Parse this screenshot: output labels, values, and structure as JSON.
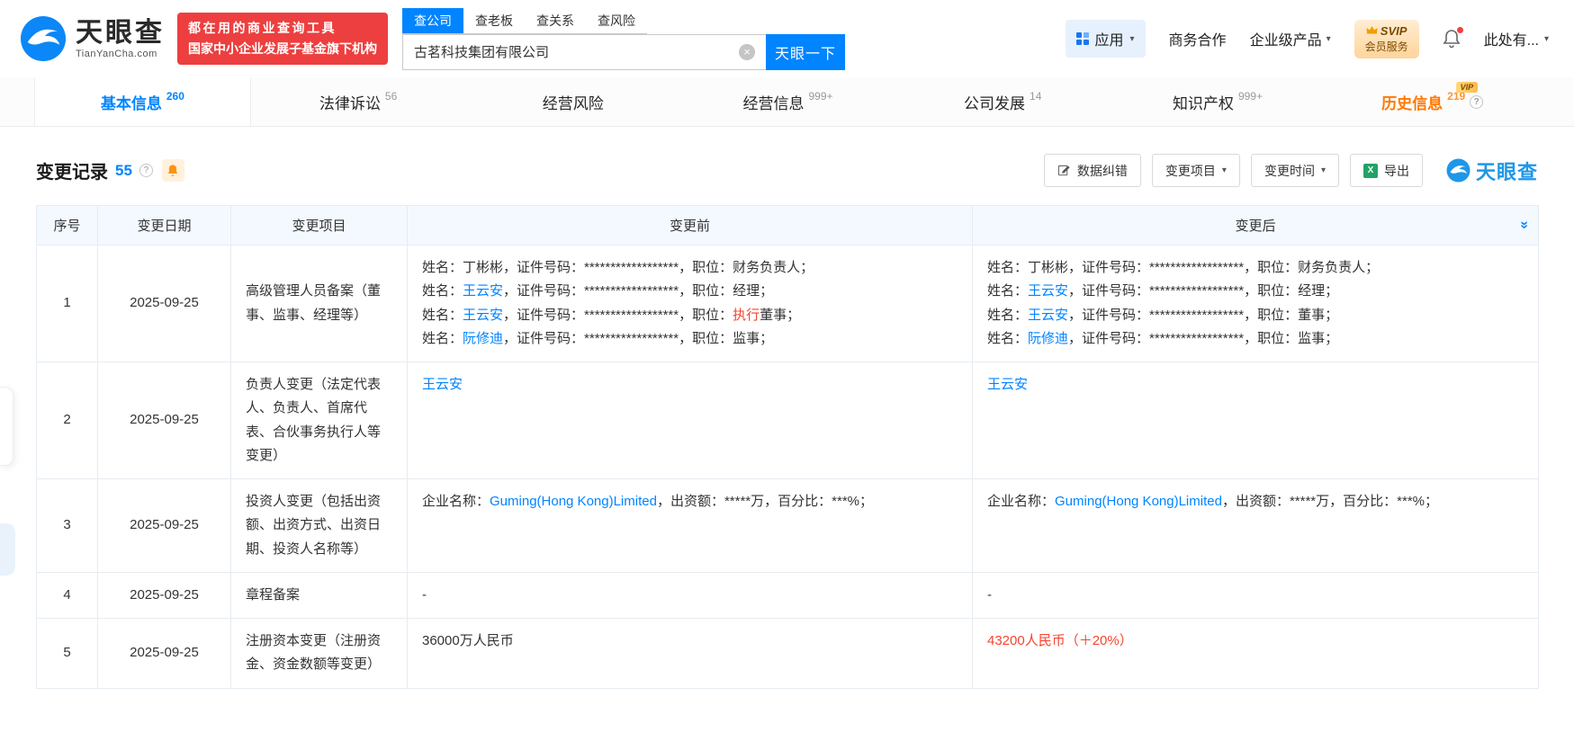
{
  "colors": {
    "brand_blue": "#0084ff",
    "link_blue": "#0084ff",
    "highlight_red": "#f5442e",
    "history_orange": "#ff7800",
    "slogan_red": "#ed3f3f",
    "table_header_bg": "#f3f9ff"
  },
  "header": {
    "logo": {
      "name": "天眼查",
      "domain": "TianYanCha.com"
    },
    "slogan": {
      "line1": "都在用的商业查询工具",
      "line2": "国家中小企业发展子基金旗下机构"
    },
    "search_tabs": [
      {
        "label": "查公司",
        "active": true
      },
      {
        "label": "查老板",
        "active": false
      },
      {
        "label": "查关系",
        "active": false
      },
      {
        "label": "查风险",
        "active": false
      }
    ],
    "search": {
      "value": "古茗科技集团有限公司",
      "button": "天眼一下"
    },
    "nav": {
      "apps": "应用",
      "cooperation": "商务合作",
      "enterprise": "企业级产品",
      "svip_top": "SVIP",
      "svip_bottom": "会员服务",
      "user": "此处有..."
    }
  },
  "tabs": [
    {
      "id": "basic-info",
      "label": "基本信息",
      "count": "260",
      "active": true
    },
    {
      "id": "legal-litigation",
      "label": "法律诉讼",
      "count": "56"
    },
    {
      "id": "operation-risk",
      "label": "经营风险",
      "count": ""
    },
    {
      "id": "operation-info",
      "label": "经营信息",
      "count": "999+"
    },
    {
      "id": "company-development",
      "label": "公司发展",
      "count": "14"
    },
    {
      "id": "intellectual-property",
      "label": "知识产权",
      "count": "999+"
    },
    {
      "id": "history-info",
      "label": "历史信息",
      "count": "219",
      "vip": "VIP",
      "info": true,
      "highlight": true
    }
  ],
  "section": {
    "title": "变更记录",
    "count": "55",
    "tools": {
      "correction": "数据纠错",
      "filter_item": "变更项目",
      "filter_time": "变更时间",
      "export": "导出"
    },
    "watermark": "天眼查"
  },
  "table": {
    "headers": [
      "序号",
      "变更日期",
      "变更项目",
      "变更前",
      "变更后"
    ],
    "rows": [
      {
        "seq": "1",
        "date": "2025-09-25",
        "item": "高级管理人员备案（董事、监事、经理等）",
        "before": [
          [
            {
              "t": "姓名：丁彬彬，证件号码：******************，职位：财务负责人；"
            }
          ],
          [
            {
              "t": "姓名："
            },
            {
              "t": "王云安",
              "link": true
            },
            {
              "t": "，证件号码：******************，职位：经理；"
            }
          ],
          [
            {
              "t": "姓名："
            },
            {
              "t": "王云安",
              "link": true
            },
            {
              "t": "，证件号码：******************，职位："
            },
            {
              "t": "执行",
              "red": true
            },
            {
              "t": "董事；"
            }
          ],
          [
            {
              "t": "姓名："
            },
            {
              "t": "阮修迪",
              "link": true
            },
            {
              "t": "，证件号码：******************，职位：监事；"
            }
          ]
        ],
        "after": [
          [
            {
              "t": "姓名：丁彬彬，证件号码：******************，职位：财务负责人；"
            }
          ],
          [
            {
              "t": "姓名："
            },
            {
              "t": "王云安",
              "link": true
            },
            {
              "t": "，证件号码：******************，职位：经理；"
            }
          ],
          [
            {
              "t": "姓名："
            },
            {
              "t": "王云安",
              "link": true
            },
            {
              "t": "，证件号码：******************，职位：董事；"
            }
          ],
          [
            {
              "t": "姓名："
            },
            {
              "t": "阮修迪",
              "link": true
            },
            {
              "t": "，证件号码：******************，职位：监事；"
            }
          ]
        ]
      },
      {
        "seq": "2",
        "date": "2025-09-25",
        "item": "负责人变更（法定代表人、负责人、首席代表、合伙事务执行人等变更）",
        "before": [
          [
            {
              "t": "王云安",
              "link": true
            }
          ]
        ],
        "after": [
          [
            {
              "t": "王云安",
              "link": true
            }
          ]
        ]
      },
      {
        "seq": "3",
        "date": "2025-09-25",
        "item": "投资人变更（包括出资额、出资方式、出资日期、投资人名称等）",
        "before": [
          [
            {
              "t": "企业名称："
            },
            {
              "t": "Guming(Hong Kong)Limited",
              "link": true
            },
            {
              "t": "，出资额：*****万，百分比：***%；"
            }
          ]
        ],
        "after": [
          [
            {
              "t": "企业名称："
            },
            {
              "t": "Guming(Hong Kong)Limited",
              "link": true
            },
            {
              "t": "，出资额：*****万，百分比：***%；"
            }
          ]
        ]
      },
      {
        "seq": "4",
        "date": "2025-09-25",
        "item": "章程备案",
        "before": [
          [
            {
              "t": "-"
            }
          ]
        ],
        "after": [
          [
            {
              "t": "-"
            }
          ]
        ]
      },
      {
        "seq": "5",
        "date": "2025-09-25",
        "item": "注册资本变更（注册资金、资金数额等变更）",
        "before": [
          [
            {
              "t": "36000万人民币"
            }
          ]
        ],
        "after": [
          [
            {
              "t": "43200人民币（＋20%）",
              "red": true
            }
          ]
        ]
      }
    ]
  },
  "icons": {
    "clear": "×",
    "caret": "▾",
    "collapse": "»",
    "question": "?",
    "excel_letter": "X"
  }
}
